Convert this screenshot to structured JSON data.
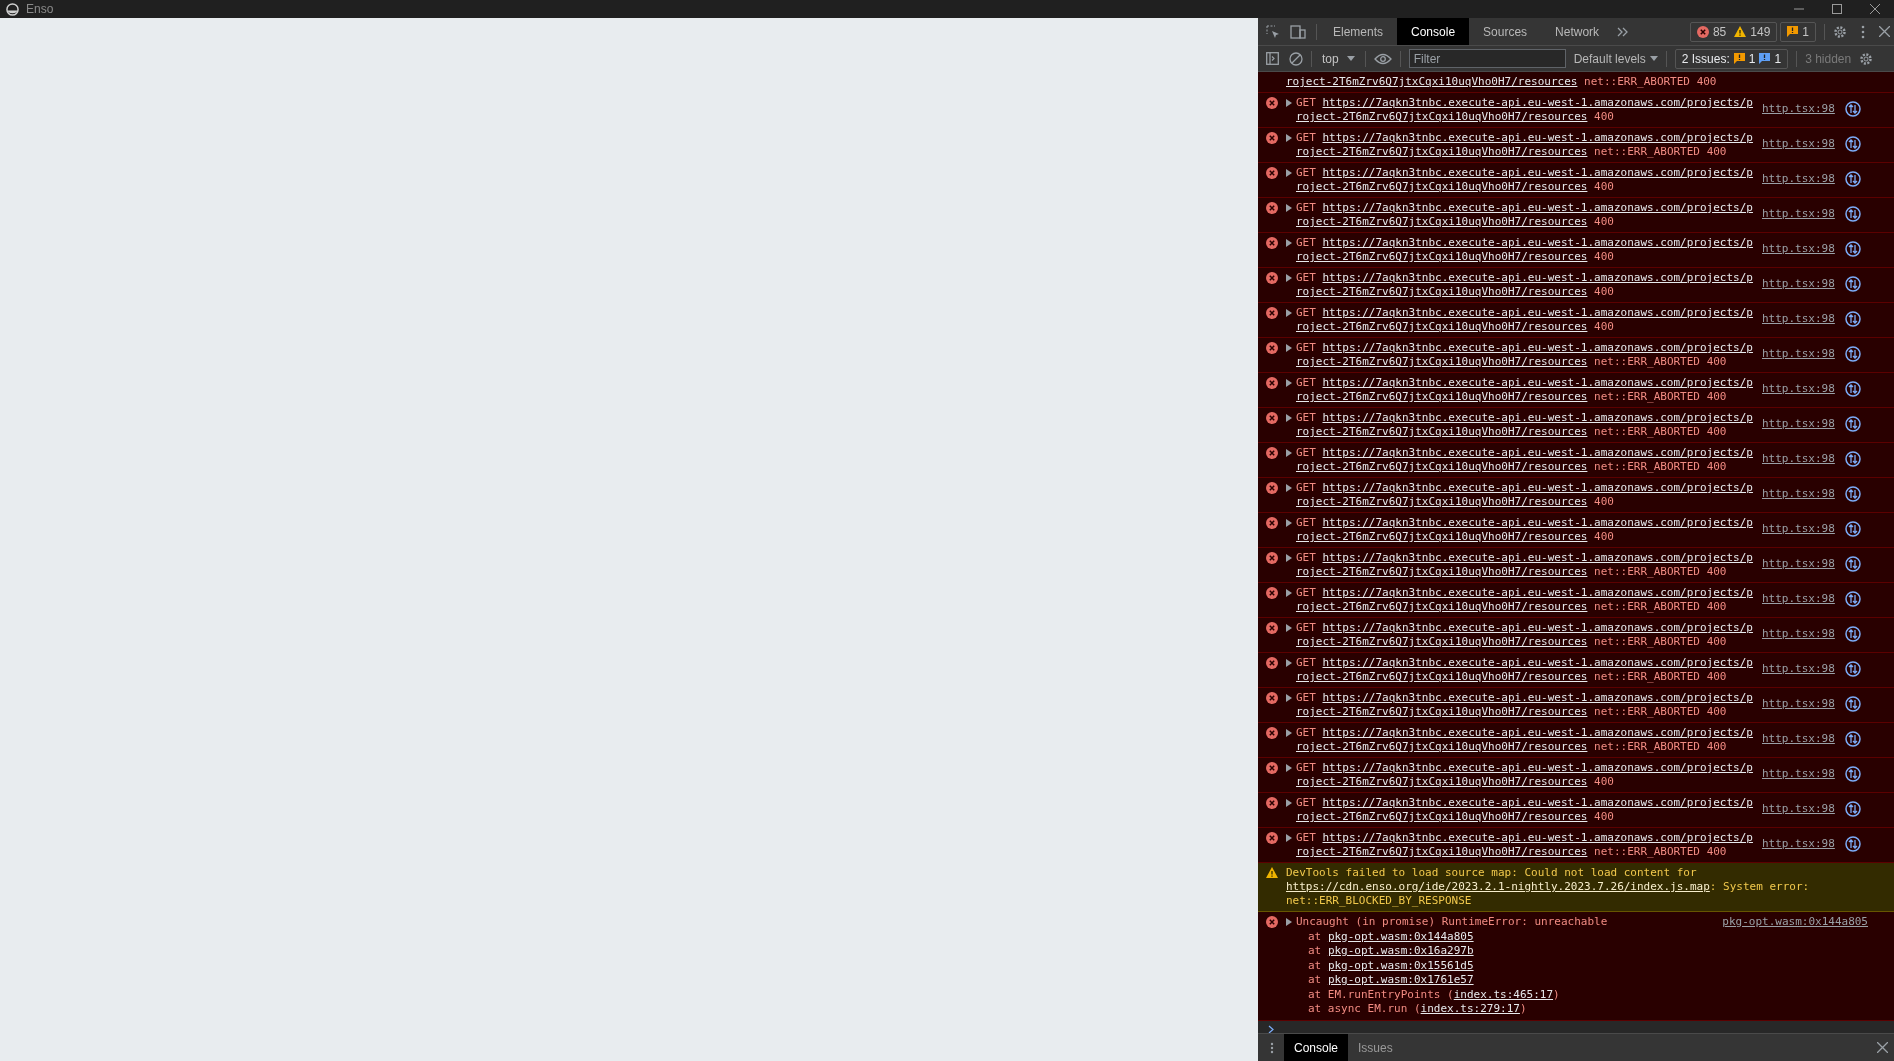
{
  "window": {
    "title": "Enso"
  },
  "devtools": {
    "tabs": [
      {
        "label": "Elements",
        "selected": false
      },
      {
        "label": "Console",
        "selected": true
      },
      {
        "label": "Sources",
        "selected": false
      },
      {
        "label": "Network",
        "selected": false
      }
    ],
    "counters": {
      "errors": "85",
      "warnings": "149",
      "issues": "1"
    },
    "context": "top",
    "filter_placeholder": "Filter",
    "levels": "Default levels",
    "issues_label": "2 Issues:",
    "issues_warn": "1",
    "issues_info": "1",
    "hidden": "3 hidden",
    "messages": [
      {
        "kind": "request_tail",
        "url": "roject-2T6mZrv6Q7jtxCqxi10uqVho0H7/resources",
        "error": "net::ERR_ABORTED",
        "status": "400"
      },
      {
        "kind": "request",
        "method": "GET",
        "url": "https://7aqkn3tnbc.execute-api.eu-west-1.amazonaws.com/projects/project-2T6mZrv6Q7jtxCqxi10uqVho0H7/resources",
        "status": "400",
        "source": "http.tsx:98"
      },
      {
        "kind": "request",
        "method": "GET",
        "url": "https://7aqkn3tnbc.execute-api.eu-west-1.amazonaws.com/projects/project-2T6mZrv6Q7jtxCqxi10uqVho0H7/resources",
        "error": "net::ERR_ABORTED",
        "status": "400",
        "source": "http.tsx:98"
      },
      {
        "kind": "request",
        "method": "GET",
        "url": "https://7aqkn3tnbc.execute-api.eu-west-1.amazonaws.com/projects/project-2T6mZrv6Q7jtxCqxi10uqVho0H7/resources",
        "status": "400",
        "source": "http.tsx:98"
      },
      {
        "kind": "request",
        "method": "GET",
        "url": "https://7aqkn3tnbc.execute-api.eu-west-1.amazonaws.com/projects/project-2T6mZrv6Q7jtxCqxi10uqVho0H7/resources",
        "status": "400",
        "source": "http.tsx:98"
      },
      {
        "kind": "request",
        "method": "GET",
        "url": "https://7aqkn3tnbc.execute-api.eu-west-1.amazonaws.com/projects/project-2T6mZrv6Q7jtxCqxi10uqVho0H7/resources",
        "status": "400",
        "source": "http.tsx:98"
      },
      {
        "kind": "request",
        "method": "GET",
        "url": "https://7aqkn3tnbc.execute-api.eu-west-1.amazonaws.com/projects/project-2T6mZrv6Q7jtxCqxi10uqVho0H7/resources",
        "status": "400",
        "source": "http.tsx:98"
      },
      {
        "kind": "request",
        "method": "GET",
        "url": "https://7aqkn3tnbc.execute-api.eu-west-1.amazonaws.com/projects/project-2T6mZrv6Q7jtxCqxi10uqVho0H7/resources",
        "status": "400",
        "source": "http.tsx:98"
      },
      {
        "kind": "request",
        "method": "GET",
        "url": "https://7aqkn3tnbc.execute-api.eu-west-1.amazonaws.com/projects/project-2T6mZrv6Q7jtxCqxi10uqVho0H7/resources",
        "error": "net::ERR_ABORTED",
        "status": "400",
        "source": "http.tsx:98"
      },
      {
        "kind": "request",
        "method": "GET",
        "url": "https://7aqkn3tnbc.execute-api.eu-west-1.amazonaws.com/projects/project-2T6mZrv6Q7jtxCqxi10uqVho0H7/resources",
        "error": "net::ERR_ABORTED",
        "status": "400",
        "source": "http.tsx:98"
      },
      {
        "kind": "request",
        "method": "GET",
        "url": "https://7aqkn3tnbc.execute-api.eu-west-1.amazonaws.com/projects/project-2T6mZrv6Q7jtxCqxi10uqVho0H7/resources",
        "error": "net::ERR_ABORTED",
        "status": "400",
        "source": "http.tsx:98"
      },
      {
        "kind": "request",
        "method": "GET",
        "url": "https://7aqkn3tnbc.execute-api.eu-west-1.amazonaws.com/projects/project-2T6mZrv6Q7jtxCqxi10uqVho0H7/resources",
        "error": "net::ERR_ABORTED",
        "status": "400",
        "source": "http.tsx:98"
      },
      {
        "kind": "request",
        "method": "GET",
        "url": "https://7aqkn3tnbc.execute-api.eu-west-1.amazonaws.com/projects/project-2T6mZrv6Q7jtxCqxi10uqVho0H7/resources",
        "status": "400",
        "source": "http.tsx:98"
      },
      {
        "kind": "request",
        "method": "GET",
        "url": "https://7aqkn3tnbc.execute-api.eu-west-1.amazonaws.com/projects/project-2T6mZrv6Q7jtxCqxi10uqVho0H7/resources",
        "status": "400",
        "source": "http.tsx:98"
      },
      {
        "kind": "request",
        "method": "GET",
        "url": "https://7aqkn3tnbc.execute-api.eu-west-1.amazonaws.com/projects/project-2T6mZrv6Q7jtxCqxi10uqVho0H7/resources",
        "error": "net::ERR_ABORTED",
        "status": "400",
        "source": "http.tsx:98"
      },
      {
        "kind": "request",
        "method": "GET",
        "url": "https://7aqkn3tnbc.execute-api.eu-west-1.amazonaws.com/projects/project-2T6mZrv6Q7jtxCqxi10uqVho0H7/resources",
        "error": "net::ERR_ABORTED",
        "status": "400",
        "source": "http.tsx:98"
      },
      {
        "kind": "request",
        "method": "GET",
        "url": "https://7aqkn3tnbc.execute-api.eu-west-1.amazonaws.com/projects/project-2T6mZrv6Q7jtxCqxi10uqVho0H7/resources",
        "error": "net::ERR_ABORTED",
        "status": "400",
        "source": "http.tsx:98"
      },
      {
        "kind": "request",
        "method": "GET",
        "url": "https://7aqkn3tnbc.execute-api.eu-west-1.amazonaws.com/projects/project-2T6mZrv6Q7jtxCqxi10uqVho0H7/resources",
        "error": "net::ERR_ABORTED",
        "status": "400",
        "source": "http.tsx:98"
      },
      {
        "kind": "request",
        "method": "GET",
        "url": "https://7aqkn3tnbc.execute-api.eu-west-1.amazonaws.com/projects/project-2T6mZrv6Q7jtxCqxi10uqVho0H7/resources",
        "error": "net::ERR_ABORTED",
        "status": "400",
        "source": "http.tsx:98"
      },
      {
        "kind": "request",
        "method": "GET",
        "url": "https://7aqkn3tnbc.execute-api.eu-west-1.amazonaws.com/projects/project-2T6mZrv6Q7jtxCqxi10uqVho0H7/resources",
        "error": "net::ERR_ABORTED",
        "status": "400",
        "source": "http.tsx:98"
      },
      {
        "kind": "request",
        "method": "GET",
        "url": "https://7aqkn3tnbc.execute-api.eu-west-1.amazonaws.com/projects/project-2T6mZrv6Q7jtxCqxi10uqVho0H7/resources",
        "status": "400",
        "source": "http.tsx:98"
      },
      {
        "kind": "request",
        "method": "GET",
        "url": "https://7aqkn3tnbc.execute-api.eu-west-1.amazonaws.com/projects/project-2T6mZrv6Q7jtxCqxi10uqVho0H7/resources",
        "status": "400",
        "source": "http.tsx:98"
      },
      {
        "kind": "request",
        "method": "GET",
        "url": "https://7aqkn3tnbc.execute-api.eu-west-1.amazonaws.com/projects/project-2T6mZrv6Q7jtxCqxi10uqVho0H7/resources",
        "error": "net::ERR_ABORTED",
        "status": "400",
        "source": "http.tsx:98"
      },
      {
        "kind": "warning",
        "text": "DevTools failed to load source map: Could not load content for ",
        "link": "https://cdn.enso.org/ide/2023.2.1-nightly.2023.7.26/index.js.map",
        "after": ": System error: net::ERR_BLOCKED_BY_RESPONSE"
      },
      {
        "kind": "exception",
        "text": "Uncaught (in promise) RuntimeError: unreachable",
        "source": "pkg-opt.wasm:0x144a805",
        "frames": [
          {
            "before": "at ",
            "link": "pkg-opt.wasm:0x144a805"
          },
          {
            "before": "at ",
            "link": "pkg-opt.wasm:0x16a297b"
          },
          {
            "before": "at ",
            "link": "pkg-opt.wasm:0x15561d5"
          },
          {
            "before": "at ",
            "link": "pkg-opt.wasm:0x1761e57"
          },
          {
            "before": "at EM.runEntryPoints (",
            "link": "index.ts:465:17",
            "after": ")"
          },
          {
            "before": "at async EM.run (",
            "link": "index.ts:279:17",
            "after": ")"
          }
        ]
      }
    ],
    "drawer_tabs": [
      {
        "label": "Console",
        "selected": true
      },
      {
        "label": "Issues",
        "selected": false
      }
    ]
  }
}
